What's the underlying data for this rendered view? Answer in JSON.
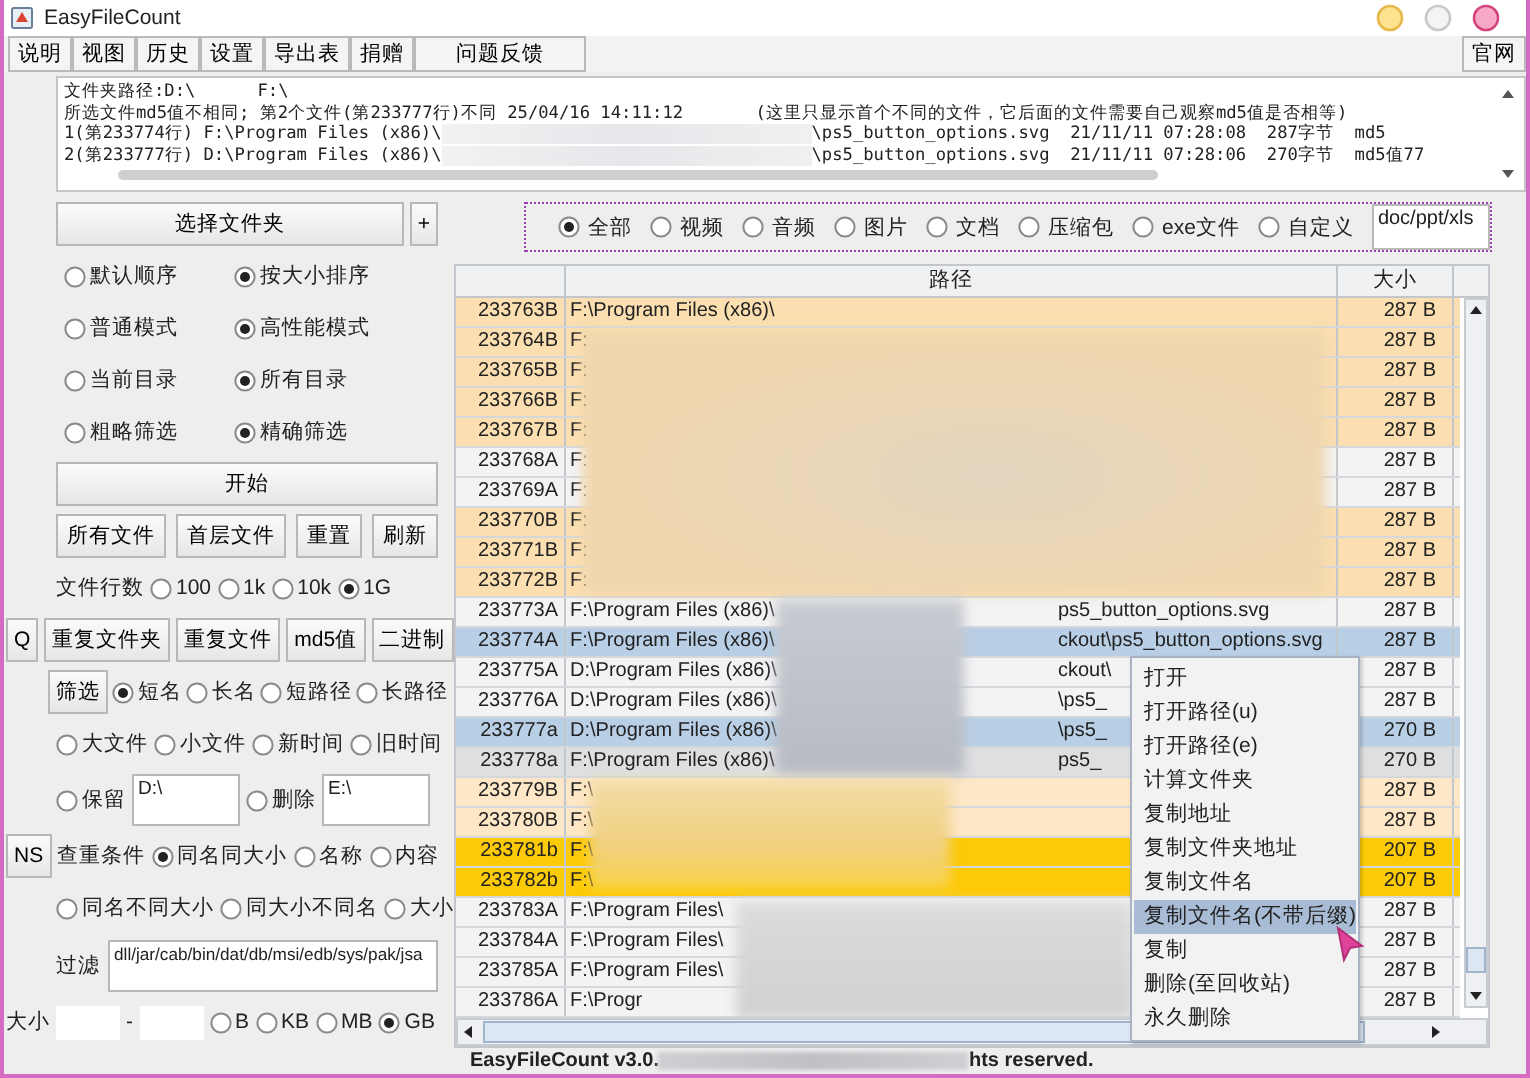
{
  "window": {
    "title": "EasyFileCount"
  },
  "menu": [
    {
      "label": "说明"
    },
    {
      "label": "视图"
    },
    {
      "label": "历史"
    },
    {
      "label": "设置"
    },
    {
      "label": "导出表"
    },
    {
      "label": "捐赠"
    },
    {
      "label": "问题反馈"
    }
  ],
  "site_button": "官网",
  "log": {
    "lines": [
      {
        "parts": [
          "文件夹路径:D:\\      F:\\"
        ]
      },
      {
        "parts": [
          "所选文件md5值不相同; 第2个文件(第233777行)不同 25/04/16 14:11:12       (这里只显示首个不同的文件，它后面的文件需要自己观察md5值是否相等)"
        ]
      },
      {
        "parts": [
          "1(第233774行) F:\\Program Files (x86)\\",
          "\\ps5_button_options.svg  21/11/11 07:28:08  287字节  md5"
        ]
      },
      {
        "parts": [
          "2(第233777行) D:\\Program Files (x86)\\",
          "\\ps5_button_options.svg  21/11/11 07:28:06  270字节  md5值77"
        ]
      }
    ]
  },
  "left_panel": [
    {
      "kind": "indented",
      "items": [
        {
          "kind": "button",
          "label": "选择文件夹"
        },
        {
          "kind": "small_button",
          "label": "+"
        }
      ]
    },
    {
      "kind": "indented",
      "items": [
        {
          "kind": "radio",
          "label": "默认顺序",
          "selected": false
        },
        {
          "kind": "radio",
          "label": "按大小排序",
          "selected": true
        }
      ]
    },
    {
      "kind": "indented",
      "items": [
        {
          "kind": "radio",
          "label": "普通模式",
          "selected": false
        },
        {
          "kind": "radio",
          "label": "高性能模式",
          "selected": true
        }
      ]
    },
    {
      "kind": "indented",
      "items": [
        {
          "kind": "radio",
          "label": "当前目录",
          "selected": false
        },
        {
          "kind": "radio",
          "label": "所有目录",
          "selected": true
        }
      ]
    },
    {
      "kind": "indented",
      "items": [
        {
          "kind": "radio",
          "label": "粗略筛选",
          "selected": false
        },
        {
          "kind": "radio",
          "label": "精确筛选",
          "selected": true
        }
      ]
    },
    {
      "kind": "indented",
      "items": [
        {
          "kind": "button",
          "label": "开始"
        }
      ]
    },
    {
      "kind": "indented",
      "items": [
        {
          "kind": "button",
          "label": "所有文件"
        },
        {
          "kind": "button",
          "label": "首层文件"
        },
        {
          "kind": "button",
          "label": "重置"
        },
        {
          "kind": "button",
          "label": "刷新"
        }
      ]
    },
    {
      "kind": "indented",
      "items": [
        {
          "kind": "label",
          "label": "文件行数"
        },
        {
          "kind": "radio",
          "label": "100",
          "selected": false
        },
        {
          "kind": "radio",
          "label": "1k",
          "selected": false
        },
        {
          "kind": "radio",
          "label": "10k",
          "selected": false
        },
        {
          "kind": "radio",
          "label": "1G",
          "selected": true
        }
      ]
    },
    {
      "kind": "flush",
      "items": [
        {
          "kind": "small_button",
          "label": "Q"
        },
        {
          "kind": "button",
          "label": "重复文件夹"
        },
        {
          "kind": "button",
          "label": "重复文件"
        },
        {
          "kind": "button",
          "label": "md5值"
        },
        {
          "kind": "button",
          "label": "二进制"
        }
      ]
    },
    {
      "kind": "indented",
      "items": [
        {
          "kind": "small_button",
          "label": "筛选"
        },
        {
          "kind": "radio",
          "label": "短名",
          "selected": true
        },
        {
          "kind": "radio",
          "label": "长名",
          "selected": false
        },
        {
          "kind": "radio",
          "label": "短路径",
          "selected": false
        },
        {
          "kind": "radio",
          "label": "长路径",
          "selected": false
        }
      ]
    },
    {
      "kind": "indented",
      "items": [
        {
          "kind": "radio",
          "label": "大文件",
          "selected": false
        },
        {
          "kind": "radio",
          "label": "小文件",
          "selected": false
        },
        {
          "kind": "radio",
          "label": "新时间",
          "selected": false
        },
        {
          "kind": "radio",
          "label": "旧时间",
          "selected": false
        }
      ]
    },
    {
      "kind": "indented",
      "items": [
        {
          "kind": "radio",
          "label": "保留",
          "selected": false
        },
        {
          "kind": "text_area",
          "value": "D:\\"
        },
        {
          "kind": "radio",
          "label": "删除",
          "selected": false
        },
        {
          "kind": "text_area",
          "value": "E:\\"
        }
      ]
    },
    {
      "kind": "flush",
      "items": [
        {
          "kind": "small_button",
          "label": "NS"
        },
        {
          "kind": "label",
          "label": "查重条件"
        },
        {
          "kind": "radio",
          "label": "同名同大小",
          "selected": true
        },
        {
          "kind": "radio",
          "label": "名称",
          "selected": false
        },
        {
          "kind": "radio",
          "label": "内容",
          "selected": false
        }
      ]
    },
    {
      "kind": "indented",
      "items": [
        {
          "kind": "radio",
          "label": "同名不同大小",
          "selected": false
        },
        {
          "kind": "radio",
          "label": "同大小不同名",
          "selected": false
        },
        {
          "kind": "radio",
          "label": "大小",
          "selected": false
        }
      ]
    },
    {
      "kind": "indented",
      "items": [
        {
          "kind": "label",
          "label": "过滤"
        },
        {
          "kind": "text_area",
          "value": "dll/jar/cab/bin/dat/db/msi/edb/sys/pak/jsa"
        }
      ]
    },
    {
      "kind": "flush",
      "items": [
        {
          "kind": "label",
          "label": "大小"
        },
        {
          "kind": "field"
        },
        {
          "kind": "label",
          "label": "-"
        },
        {
          "kind": "field"
        },
        {
          "kind": "radio",
          "label": "B",
          "selected": false
        },
        {
          "kind": "radio",
          "label": "KB",
          "selected": false
        },
        {
          "kind": "radio",
          "label": "MB",
          "selected": false
        },
        {
          "kind": "radio",
          "label": "GB",
          "selected": true
        }
      ]
    }
  ],
  "type_filter": {
    "options": [
      {
        "label": "全部",
        "selected": true
      },
      {
        "label": "视频",
        "selected": false
      },
      {
        "label": "音频",
        "selected": false
      },
      {
        "label": "图片",
        "selected": false
      },
      {
        "label": "文档",
        "selected": false
      },
      {
        "label": "压缩包",
        "selected": false
      },
      {
        "label": "exe文件",
        "selected": false
      },
      {
        "label": "自定义",
        "selected": false
      }
    ],
    "custom": "doc/ppt/xls"
  },
  "table": {
    "columns": [
      "路径",
      "大小"
    ],
    "rows": [
      {
        "id": "233763B",
        "path": [
          "F:\\Program Files (x86)\\"
        ],
        "size": "287 B",
        "color": "#fbdfb0"
      },
      {
        "id": "233764B",
        "path": [
          "F:"
        ],
        "size": "287 B",
        "color": "#fbdfb0"
      },
      {
        "id": "233765B",
        "path": [
          "F:"
        ],
        "size": "287 B",
        "color": "#fbdfb0"
      },
      {
        "id": "233766B",
        "path": [
          "F:"
        ],
        "size": "287 B",
        "color": "#fbdfb0"
      },
      {
        "id": "233767B",
        "path": [
          "F:"
        ],
        "size": "287 B",
        "color": "#fbdfb0"
      },
      {
        "id": "233768A",
        "path": [
          "F:"
        ],
        "size": "287 B",
        "color": "#f3f3f4"
      },
      {
        "id": "233769A",
        "path": [
          "F:"
        ],
        "size": "287 B",
        "color": "#f3f3f4"
      },
      {
        "id": "233770B",
        "path": [
          "F:"
        ],
        "size": "287 B",
        "color": "#fbdfb0"
      },
      {
        "id": "233771B",
        "path": [
          "F:"
        ],
        "size": "287 B",
        "color": "#fbdfb0"
      },
      {
        "id": "233772B",
        "path": [
          "F:"
        ],
        "size": "287 B",
        "color": "#fbdfb0"
      },
      {
        "id": "233773A",
        "path": [
          "F:\\Program Files (x86)\\",
          "ps5_button_options.svg"
        ],
        "size": "287 B",
        "color": "#f3f3f4"
      },
      {
        "id": "233774A",
        "path": [
          "F:\\Program Files (x86)\\",
          "ckout\\ps5_button_options.svg"
        ],
        "size": "287 B",
        "color": "#b9cfe6"
      },
      {
        "id": "233775A",
        "path": [
          "D:\\Program Files (x86)\\",
          "ckout\\"
        ],
        "size": "287 B",
        "color": "#f3f3f4"
      },
      {
        "id": "233776A",
        "path": [
          "D:\\Program Files (x86)\\",
          "\\ps5_"
        ],
        "size": "287 B",
        "color": "#f3f3f4"
      },
      {
        "id": "233777a",
        "path": [
          "D:\\Program Files (x86)\\",
          "\\ps5_"
        ],
        "size": "270 B",
        "color": "#b9cfe6"
      },
      {
        "id": "233778a",
        "path": [
          "F:\\Program Files (x86)\\",
          "ps5_"
        ],
        "size": "270 B",
        "color": "#dedfe1"
      },
      {
        "id": "233779B",
        "path": [
          "F:\\"
        ],
        "size": "287 B",
        "color": "#fde7c6"
      },
      {
        "id": "233780B",
        "path": [
          "F:\\"
        ],
        "size": "287 B",
        "color": "#fde7c6"
      },
      {
        "id": "233781b",
        "path": [
          "F:\\"
        ],
        "size": "207 B",
        "color": "#fdca08"
      },
      {
        "id": "233782b",
        "path": [
          "F:\\"
        ],
        "size": "207 B",
        "color": "#fdca08"
      },
      {
        "id": "233783A",
        "path": [
          "F:\\Program Files\\"
        ],
        "size": "287 B",
        "color": "#f3f3f4"
      },
      {
        "id": "233784A",
        "path": [
          "F:\\Program Files\\"
        ],
        "size": "287 B",
        "color": "#f3f3f4"
      },
      {
        "id": "233785A",
        "path": [
          "F:\\Program Files\\"
        ],
        "size": "287 B",
        "color": "#f3f3f4"
      },
      {
        "id": "233786A",
        "path": [
          "F:\\Progr"
        ],
        "size": "287 B",
        "color": "#f3f3f4"
      }
    ]
  },
  "context_menu": {
    "items": [
      {
        "label": "打开",
        "selected": false
      },
      {
        "label": "打开路径(u)",
        "selected": false
      },
      {
        "label": "打开路径(e)",
        "selected": false
      },
      {
        "label": "计算文件夹",
        "selected": false
      },
      {
        "label": "复制地址",
        "selected": false
      },
      {
        "label": "复制文件夹地址",
        "selected": false
      },
      {
        "label": "复制文件名",
        "selected": false
      },
      {
        "label": "复制文件名(不带后缀)",
        "selected": true
      },
      {
        "label": "复制",
        "selected": false
      },
      {
        "label": "删除(至回收站)",
        "selected": false
      },
      {
        "label": "永久删除",
        "selected": false
      }
    ]
  },
  "footer": [
    "EasyFileCount v3.0.",
    "hts reserved."
  ]
}
